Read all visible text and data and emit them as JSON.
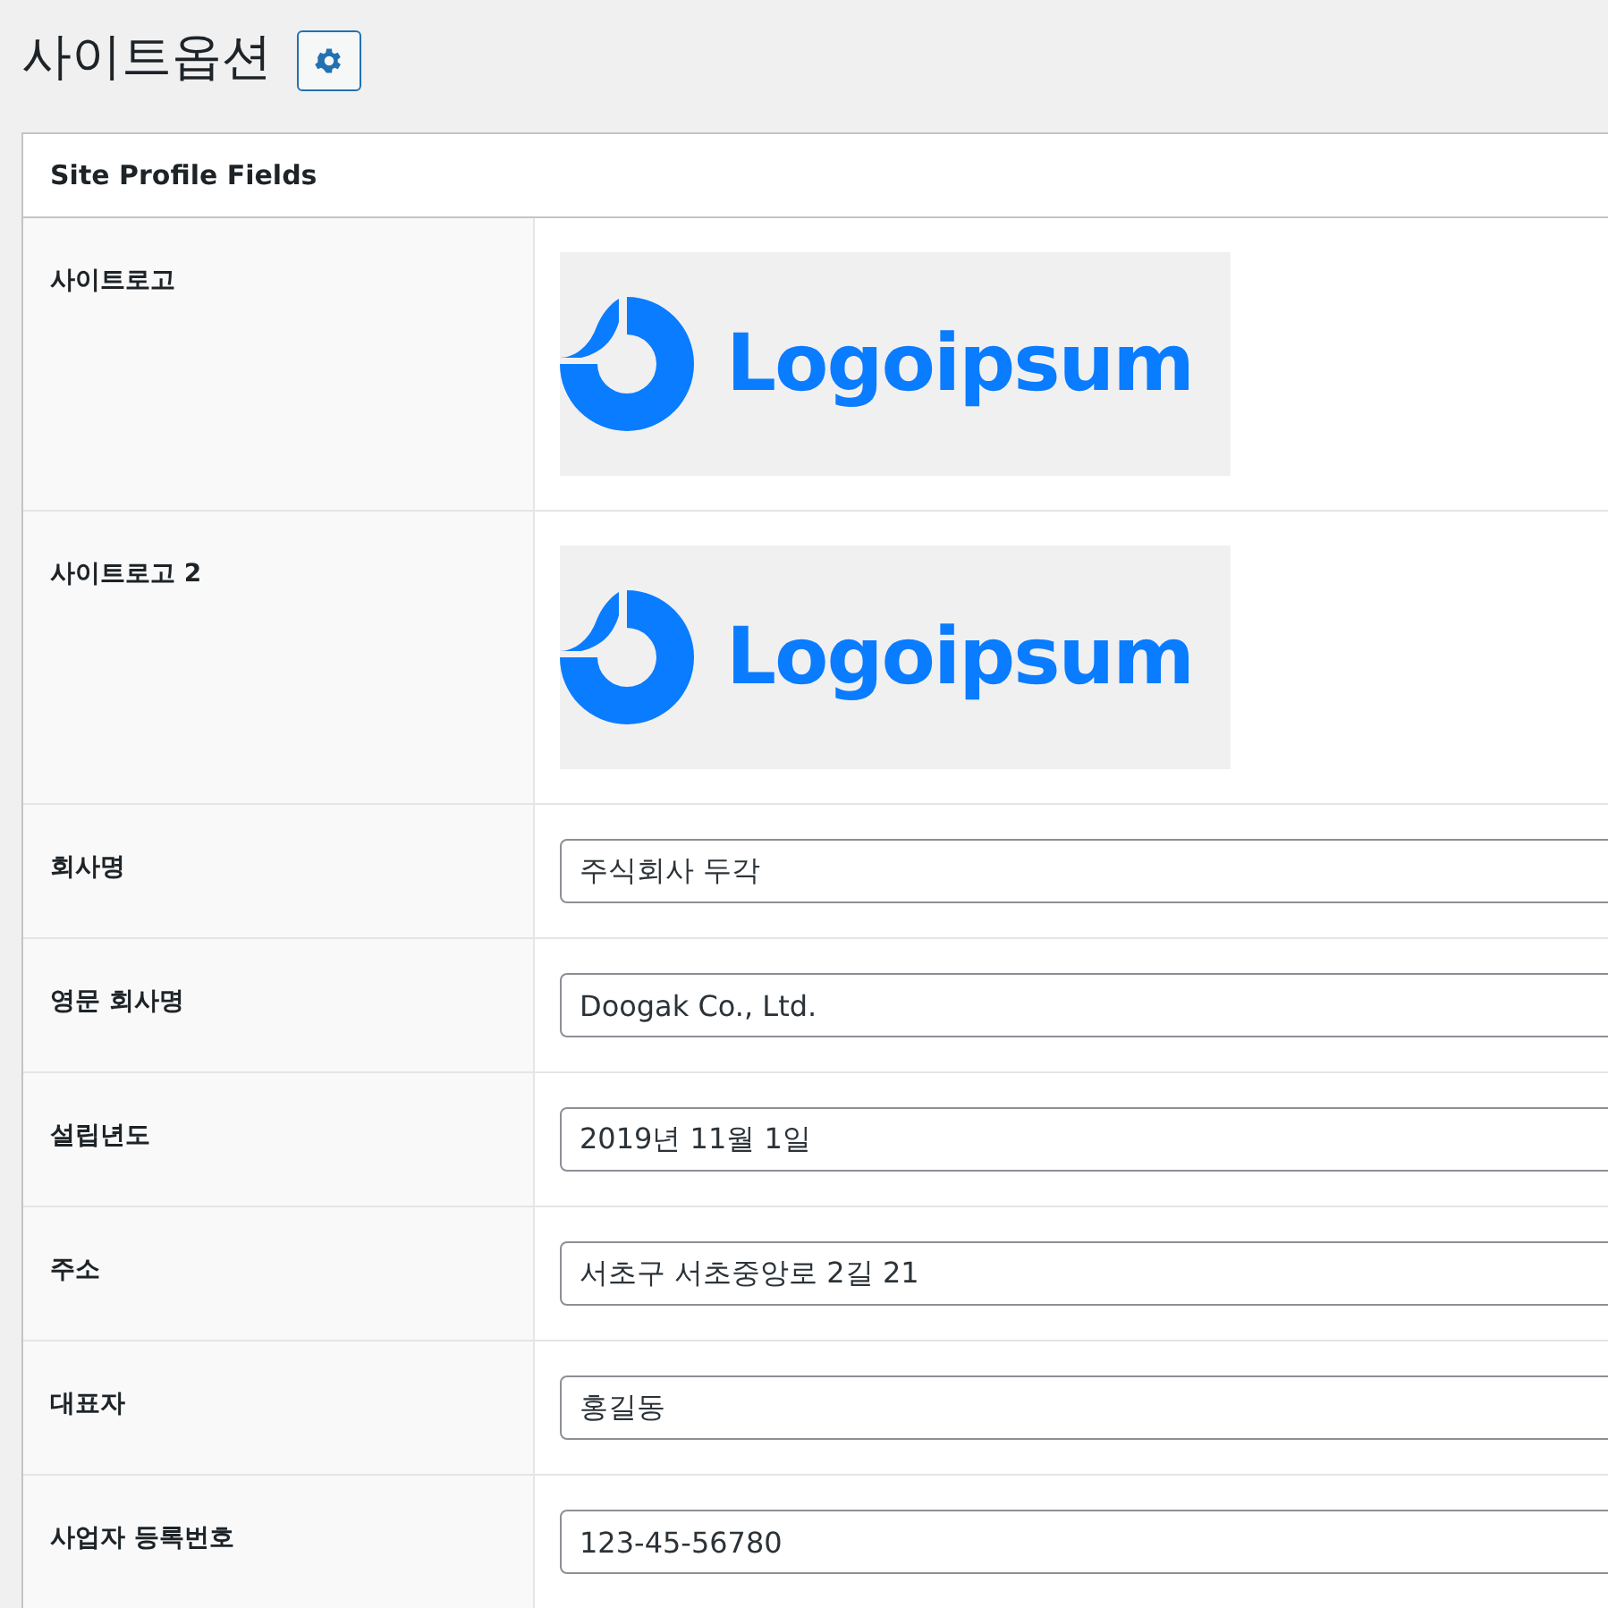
{
  "page": {
    "title": "사이트옵션"
  },
  "panel": {
    "title": "Site Profile Fields",
    "rows": [
      {
        "kind": "image",
        "label": "사이트로고",
        "logo_text": "Logoipsum"
      },
      {
        "kind": "image",
        "label": "사이트로고 2",
        "logo_text": "Logoipsum"
      },
      {
        "kind": "text",
        "label": "회사명",
        "value": "주식회사 두각"
      },
      {
        "kind": "text",
        "label": "영문 회사명",
        "value": "Doogak Co., Ltd."
      },
      {
        "kind": "text",
        "label": "설립년도",
        "value": "2019년 11월 1일"
      },
      {
        "kind": "text",
        "label": "주소",
        "value": "서초구 서초중앙로 2길 21"
      },
      {
        "kind": "text",
        "label": "대표자",
        "value": "홍길동"
      },
      {
        "kind": "text",
        "label": "사업자 등록번호",
        "value": "123-45-56780"
      }
    ]
  }
}
